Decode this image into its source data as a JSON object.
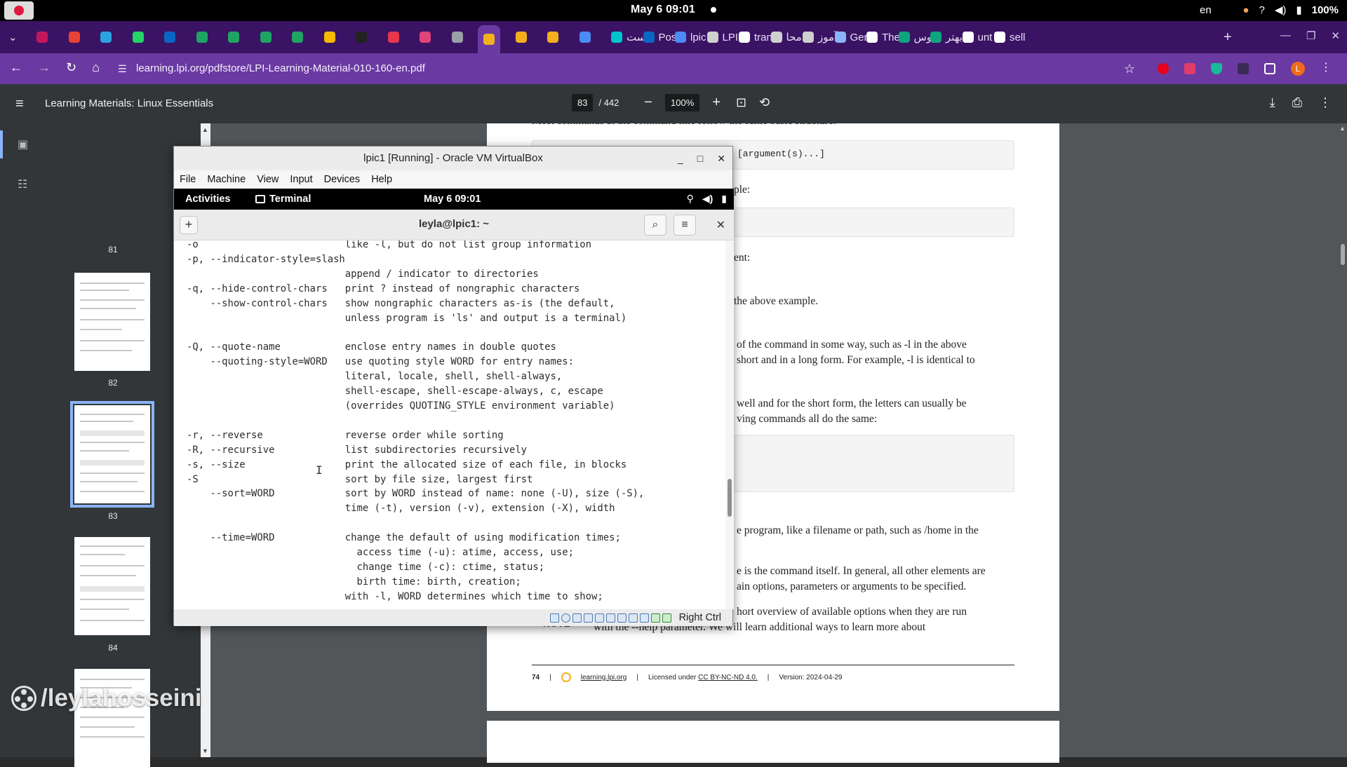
{
  "system": {
    "clock": "May 6  09:01",
    "language": "en",
    "battery": "100%"
  },
  "browser": {
    "tabs": [
      {
        "label": "",
        "color": "#c2185b"
      },
      {
        "label": "",
        "color": "#e94235"
      },
      {
        "label": "",
        "color": "#2aa3e0"
      },
      {
        "label": "",
        "color": "#25d366"
      },
      {
        "label": "",
        "color": "#0a66c2"
      },
      {
        "label": "",
        "color": "#1fa463"
      },
      {
        "label": "",
        "color": "#1fa463"
      },
      {
        "label": "",
        "color": "#1fa463"
      },
      {
        "label": "",
        "color": "#1fa463"
      },
      {
        "label": "",
        "color": "#f6b900"
      },
      {
        "label": "",
        "color": "#222222"
      },
      {
        "label": "",
        "color": "#e8364b"
      },
      {
        "label": "",
        "color": "#e0447a"
      },
      {
        "label": "",
        "color": "#9aa0a6"
      },
      {
        "label": "",
        "color": "#f2b01e"
      },
      {
        "label": "",
        "color": "#f2b01e"
      },
      {
        "label": "",
        "color": "#f2b01e"
      },
      {
        "label": "",
        "color": "#4c8bf5"
      },
      {
        "label": "است",
        "color": "#00c4cc"
      },
      {
        "label": "Pos",
        "color": "#0a66c2"
      },
      {
        "label": "lpic",
        "color": "#4c8bf5"
      },
      {
        "label": "LPI",
        "color": "#cfcfcf"
      },
      {
        "label": "tran",
        "color": "#ffffff"
      },
      {
        "label": "محا",
        "color": "#cfcfcf"
      },
      {
        "label": "آموز",
        "color": "#cfcfcf"
      },
      {
        "label": "Ger",
        "color": "#8ab4f8"
      },
      {
        "label": "The",
        "color": "#ffffff"
      },
      {
        "label": "توس",
        "color": "#10a37f"
      },
      {
        "label": "بهتر",
        "color": "#10a37f"
      },
      {
        "label": "unt",
        "color": "#ffffff"
      },
      {
        "label": "sell",
        "color": "#ffffff"
      }
    ],
    "url": "learning.lpi.org/pdfstore/LPI-Learning-Material-010-160-en.pdf",
    "profile_initial": "L"
  },
  "pdf": {
    "title": "Learning Materials: Linux Essentials",
    "page_current": "83",
    "page_total": "/ 442",
    "zoom": "100%",
    "thumbs": [
      "81",
      "82",
      "83",
      "84"
    ],
    "lines": [
      "Most commands at the command line follow the same basic structure:",
      "[argument(s)...]",
      "ple:",
      "ent:",
      "the above example.",
      "of the command in some way, such as -l in the above",
      "short and in a long form. For example, -l is identical to",
      "well and for the short form, the letters can usually be",
      "ving commands all do the same:",
      "e program, like a filename or path, such as /home in the",
      "e is the command itself. In general, all other elements are",
      "ain options, parameters or arguments to be specified.",
      "hort overview of available options when they are run",
      "with the --help parameter. We will learn additional ways to learn more about"
    ],
    "note_label": "NOTE",
    "footer": {
      "page_no": "74",
      "site": "learning.lpi.org",
      "license_prefix": "Licensed under",
      "license": "CC BY-NC-ND 4.0.",
      "version": "Version: 2024-04-29"
    }
  },
  "watermark": "/leylahosseini",
  "vbox": {
    "title": "lpic1 [Running] - Oracle VM VirtualBox",
    "menu": [
      "File",
      "Machine",
      "View",
      "Input",
      "Devices",
      "Help"
    ],
    "guest": {
      "activities": "Activities",
      "app": "Terminal",
      "clock": "May 6  09:01"
    },
    "terminal": {
      "title": "leyla@lpic1: ~",
      "lines": [
        "-o                         like -l, but do not list group information",
        "-p, --indicator-style=slash",
        "                           append / indicator to directories",
        "-q, --hide-control-chars   print ? instead of nongraphic characters",
        "    --show-control-chars   show nongraphic characters as-is (the default,",
        "                           unless program is 'ls' and output is a terminal)",
        "",
        "-Q, --quote-name           enclose entry names in double quotes",
        "    --quoting-style=WORD   use quoting style WORD for entry names:",
        "                           literal, locale, shell, shell-always,",
        "                           shell-escape, shell-escape-always, c, escape",
        "                           (overrides QUOTING_STYLE environment variable)",
        "",
        "-r, --reverse              reverse order while sorting",
        "-R, --recursive            list subdirectories recursively",
        "-s, --size                 print the allocated size of each file, in blocks",
        "-S                         sort by file size, largest first",
        "    --sort=WORD            sort by WORD instead of name: none (-U), size (-S),",
        "                           time (-t), version (-v), extension (-X), width",
        "",
        "    --time=WORD            change the default of using modification times;",
        "                             access time (-u): atime, access, use;",
        "                             change time (-c): ctime, status;",
        "                             birth time: birth, creation;",
        "                           with -l, WORD determines which time to show;"
      ]
    },
    "host_key": "Right Ctrl"
  }
}
